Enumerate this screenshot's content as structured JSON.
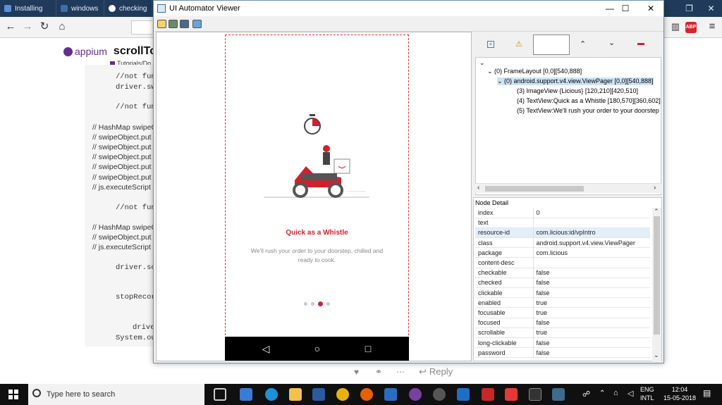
{
  "browser": {
    "tabs": [
      "Installing",
      "windows",
      "checking"
    ],
    "site_logo": "appium",
    "page_heading": "scrollTo",
    "breadcrumb": "Tutorials/Do"
  },
  "code_lines": [
    {
      "text": "//not fun",
      "mono": true
    },
    {
      "text": "driver.sw",
      "mono": true
    },
    {
      "text": "//not fun",
      "mono": true
    },
    {
      "text": "// HashMap swipeO",
      "mono": false
    },
    {
      "text": "// swipeObject.put",
      "mono": false
    },
    {
      "text": "// swipeObject.put",
      "mono": false
    },
    {
      "text": "// swipeObject.put",
      "mono": false
    },
    {
      "text": "// swipeObject.put",
      "mono": false
    },
    {
      "text": "// swipeObject.put",
      "mono": false
    },
    {
      "text": "// js.executeScript",
      "mono": false
    },
    {
      "text": "//not fun",
      "mono": true
    },
    {
      "text": "// HashMap swipeO",
      "mono": false
    },
    {
      "text": "// swipeObject.put",
      "mono": false
    },
    {
      "text": "// js.executeScript",
      "mono": false
    },
    {
      "text": "driver.sc",
      "mono": true
    },
    {
      "text": "stopRecor",
      "mono": true
    },
    {
      "text": "drive",
      "mono": true
    },
    {
      "text": "System.ou",
      "mono": true
    }
  ],
  "reply": {
    "label": "Reply"
  },
  "window": {
    "title": "UI Automator Viewer"
  },
  "phone": {
    "headline": "Quick as a Whistle",
    "body": "We'll rush your order to your doorstep, chilled and ready to cook.",
    "active_dot": 2,
    "dot_count": 4,
    "accent": "#d0202e"
  },
  "tree": [
    {
      "label": "(0) FrameLayout [0,0][540,888]",
      "depth": 1,
      "selected": false
    },
    {
      "label": "(0) android.support.v4.view.ViewPager [0,0][540,888]",
      "depth": 2,
      "selected": true
    },
    {
      "label": "(3) ImageView {Licious} [120,210][420,510]",
      "depth": 3,
      "selected": false
    },
    {
      "label": "(4) TextView:Quick as a Whistle [180,570][360,602]",
      "depth": 3,
      "selected": false
    },
    {
      "label": "(5) TextView:We'll rush your order to your doorstep",
      "depth": 3,
      "selected": false
    }
  ],
  "node_detail": {
    "title": "Node Detail",
    "rows": [
      {
        "k": "index",
        "v": "0"
      },
      {
        "k": "text",
        "v": ""
      },
      {
        "k": "resource-id",
        "v": "com.licious:id/vpIntro"
      },
      {
        "k": "class",
        "v": "android.support.v4.view.ViewPager"
      },
      {
        "k": "package",
        "v": "com.licious"
      },
      {
        "k": "content-desc",
        "v": ""
      },
      {
        "k": "checkable",
        "v": "false"
      },
      {
        "k": "checked",
        "v": "false"
      },
      {
        "k": "clickable",
        "v": "false"
      },
      {
        "k": "enabled",
        "v": "true"
      },
      {
        "k": "focusable",
        "v": "true"
      },
      {
        "k": "focused",
        "v": "false"
      },
      {
        "k": "scrollable",
        "v": "true"
      },
      {
        "k": "long-clickable",
        "v": "false"
      },
      {
        "k": "password",
        "v": "false"
      }
    ]
  },
  "taskbar": {
    "search_placeholder": "Type here to search",
    "lang": "ENG",
    "layout": "INTL",
    "time": "12:04",
    "date": "15-05-2018"
  }
}
